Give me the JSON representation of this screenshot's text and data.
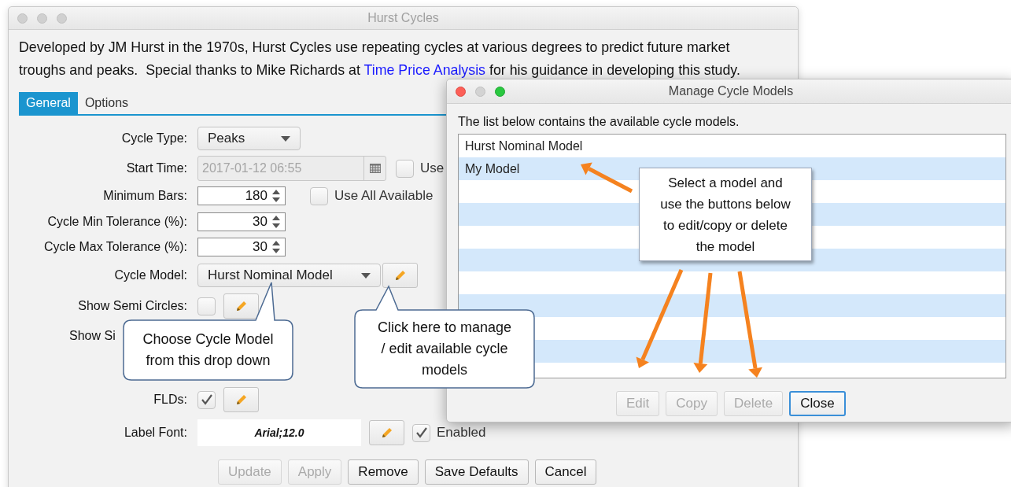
{
  "window": {
    "title": "Hurst Cycles"
  },
  "description": {
    "text": "Developed by JM Hurst in the 1970s, Hurst Cycles use repeating cycles at various degrees to predict future market troughs and peaks.  Special thanks to Mike Richards at ",
    "link": "Time Price Analysis",
    "after": " for his guidance in developing this study."
  },
  "tabs": [
    {
      "label": "General",
      "selected": true
    },
    {
      "label": "Options",
      "selected": false
    }
  ],
  "form": [
    {
      "kind": "select",
      "label": "Cycle Type:",
      "value": "Peaks"
    },
    {
      "kind": "date",
      "label": "Start Time:",
      "value": "2017-01-12 06:55",
      "disabled": true,
      "check": {
        "checked": false,
        "label": "Use"
      }
    },
    {
      "kind": "spinner",
      "label": "Minimum Bars:",
      "value": "180",
      "check": {
        "checked": false,
        "label": "Use All Available"
      }
    },
    {
      "kind": "spinner",
      "label": "Cycle Min Tolerance (%):",
      "value": "30"
    },
    {
      "kind": "spinner",
      "label": "Cycle Max Tolerance (%):",
      "value": "30"
    },
    {
      "kind": "select-edit",
      "label": "Cycle Model:",
      "value": "Hurst Nominal Model"
    },
    {
      "kind": "check-edit",
      "label": "Show Semi Circles:",
      "checked": false
    },
    {
      "kind": "cut",
      "label": "Show Si"
    },
    {
      "kind": "check-edit",
      "label": "FLDs:",
      "checked": true
    },
    {
      "kind": "font",
      "label": "Label Font:",
      "value": "Arial;12.0",
      "check": {
        "checked": true,
        "label": "Enabled"
      }
    }
  ],
  "buttons": [
    {
      "label": "Update",
      "disabled": true
    },
    {
      "label": "Apply",
      "disabled": true
    },
    {
      "label": "Remove",
      "disabled": false
    },
    {
      "label": "Save Defaults",
      "disabled": false
    },
    {
      "label": "Cancel",
      "disabled": false
    }
  ],
  "dialog": {
    "title": "Manage Cycle Models",
    "active": true,
    "intro": "The list below contains the available cycle models.",
    "models": [
      "Hurst Nominal Model",
      "My Model"
    ],
    "buttons": [
      {
        "label": "Edit",
        "disabled": true,
        "default": false
      },
      {
        "label": "Copy",
        "disabled": true,
        "default": false
      },
      {
        "label": "Delete",
        "disabled": true,
        "default": false
      },
      {
        "label": "Close",
        "disabled": false,
        "default": true
      }
    ]
  },
  "callouts": [
    {
      "kind": "bubble",
      "text": "Choose Cycle Model from this drop down"
    },
    {
      "kind": "bubble",
      "text": "Click here to manage / edit available cycle models"
    },
    {
      "kind": "note",
      "text": "Select a model and use the buttons below to edit/copy or delete the model"
    }
  ]
}
